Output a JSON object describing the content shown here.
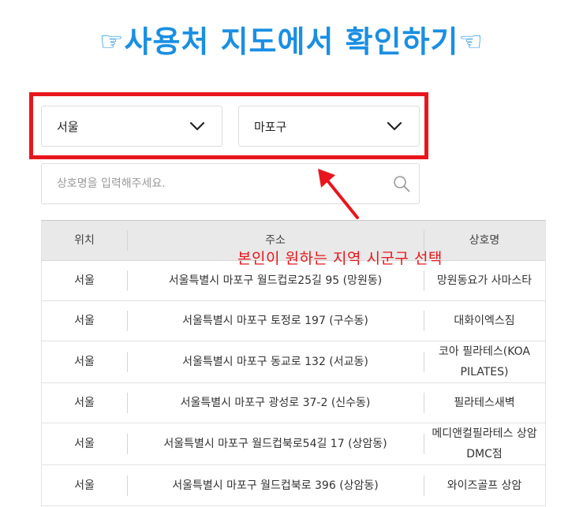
{
  "page": {
    "title": "사용처 지도에서 확인하기",
    "title_icon_left": "☞",
    "title_icon_right": "☜",
    "accent_color": "#1a8fe3",
    "highlight_color": "#e8161c"
  },
  "filters": {
    "region": "서울",
    "district": "마포구",
    "chevron_icon": "chevron-down-icon"
  },
  "search": {
    "placeholder": "상호명을 입력해주세요.",
    "value": "",
    "icon": "search-icon"
  },
  "annotation": {
    "text": "본인이 원하는 지역 시군구 선택"
  },
  "table": {
    "headers": [
      "위치",
      "주소",
      "상호명"
    ],
    "rows": [
      {
        "location": "서울",
        "address": "서울특별시 마포구 월드컵로25길 95 (망원동)",
        "name": "망원동요가 사마스타"
      },
      {
        "location": "서울",
        "address": "서울특별시 마포구 토정로 197 (구수동)",
        "name": "대화이엑스짐"
      },
      {
        "location": "서울",
        "address": "서울특별시 마포구 동교로 132 (서교동)",
        "name": "코아 필라테스(KOA PILATES)"
      },
      {
        "location": "서울",
        "address": "서울특별시 마포구 광성로 37-2 (신수동)",
        "name": "필라테스새벽"
      },
      {
        "location": "서울",
        "address": "서울특별시 마포구 월드컵북로54길 17 (상암동)",
        "name": "메디앤컬필라테스 상암DMC점"
      },
      {
        "location": "서울",
        "address": "서울특별시 마포구 월드컵북로 396 (상암동)",
        "name": "와이즈골프 상암"
      }
    ]
  }
}
